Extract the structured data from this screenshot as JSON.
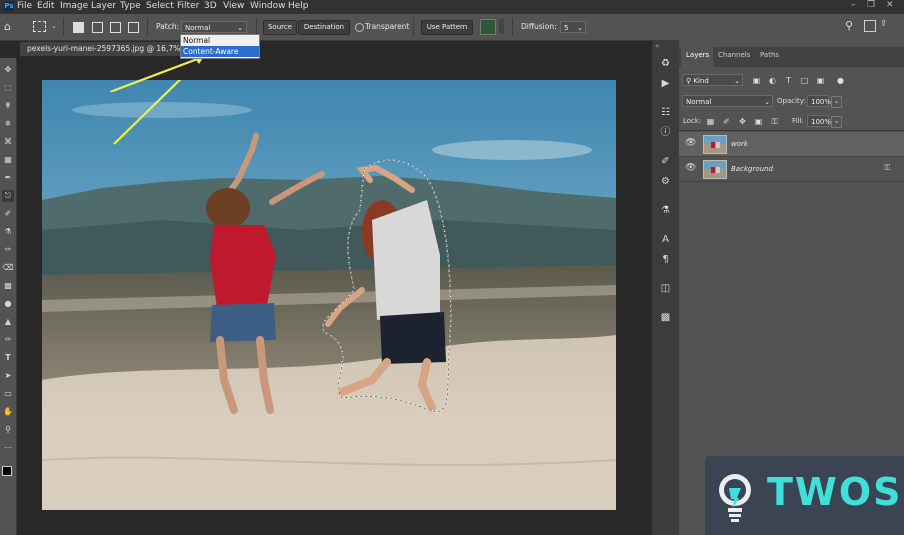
{
  "app": {
    "logo_text": "Ps"
  },
  "menu": [
    "File",
    "Edit",
    "Image",
    "Layer",
    "Type",
    "Select",
    "Filter",
    "3D",
    "View",
    "Window",
    "Help"
  ],
  "window_controls": [
    "minimize",
    "restore",
    "close"
  ],
  "options_bar": {
    "patch_label": "Patch:",
    "patch_value": "Normal",
    "source_label": "Source",
    "destination_label": "Destination",
    "transparent_label": "Transparent",
    "use_pattern_label": "Use Pattern",
    "diffusion_label": "Diffusion:",
    "diffusion_value": "5"
  },
  "patch_dropdown": {
    "options": [
      "Normal",
      "Content-Aware"
    ],
    "selected": "Content-Aware"
  },
  "document": {
    "tab_title": "pexels-yuri-manei-2597365.jpg @ 16,7% ("
  },
  "panel": {
    "tabs": [
      "Layers",
      "Channels",
      "Paths"
    ],
    "active_tab": "Layers",
    "filter_kind": "Kind",
    "blend_mode": "Normal",
    "opacity_label": "Opacity:",
    "opacity_value": "100%",
    "lock_label": "Lock:",
    "fill_label": "Fill:",
    "fill_value": "100%",
    "layers": [
      {
        "name": "work",
        "visible": true,
        "selected": true
      },
      {
        "name": "Background",
        "visible": true,
        "locked": true
      }
    ]
  },
  "watermark": {
    "text": "TWOS"
  },
  "colors": {
    "accent": "#2a6dcc",
    "watermark_text": "#3fe0d9",
    "annotation_arrow": "#f0f040"
  }
}
